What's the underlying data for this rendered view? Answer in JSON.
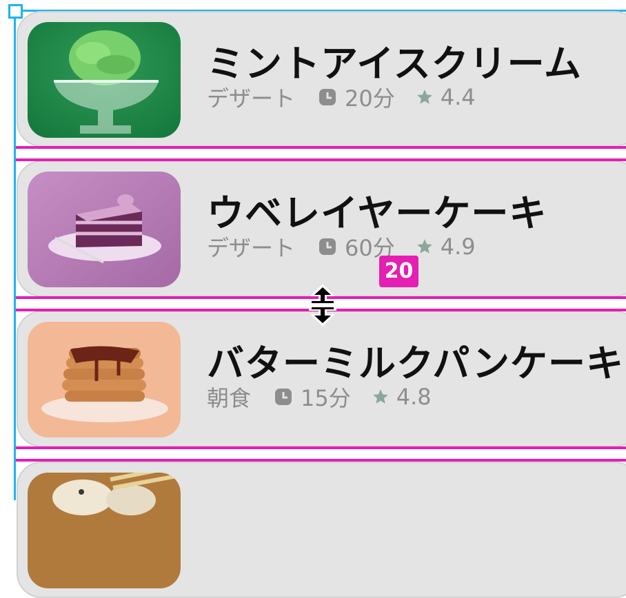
{
  "recipes": [
    {
      "title": "ミントアイスクリーム",
      "category": "デザート",
      "time": "20分",
      "rating": "4.4",
      "image": "mint-ice-cream"
    },
    {
      "title": "ウベレイヤーケーキ",
      "category": "デザート",
      "time": "60分",
      "rating": "4.9",
      "image": "ube-layer-cake"
    },
    {
      "title": "バターミルクパンケーキ",
      "category": "朝食",
      "time": "15分",
      "rating": "4.8",
      "image": "buttermilk-pancakes"
    },
    {
      "image": "dumplings"
    }
  ],
  "spacing_indicator": {
    "value": "20"
  },
  "icons": {
    "clock": "clock-icon",
    "star": "star-icon",
    "cursor": "resize-vertical-cursor"
  },
  "colors": {
    "card_bg": "#e4e4e4",
    "guide": "#e41fb4",
    "selection": "#1db3ee",
    "star": "#8aa89a",
    "meta_text": "#8d8d8d"
  }
}
